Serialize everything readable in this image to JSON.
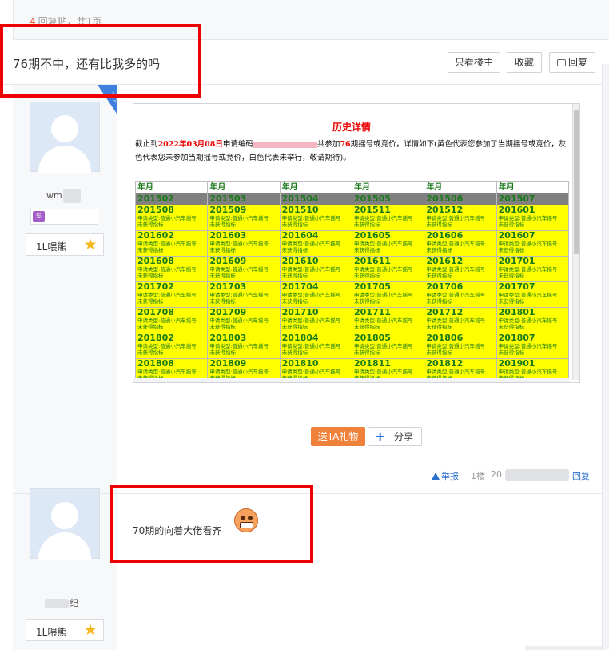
{
  "topbar": {
    "reply_num": "4",
    "reply_text": "回复贴，共1页"
  },
  "thread": {
    "title": "76期不中，还有比我多的吗",
    "buttons": {
      "only_op": "只看楼主",
      "favorite": "收藏",
      "reply": "回复"
    }
  },
  "post1": {
    "user": {
      "name": "wm",
      "level_name": "1L喂熊"
    },
    "corner_badge": "楼主",
    "screenshot": {
      "title": "历史详情",
      "desc_prefix": "截止到",
      "desc_date": "2022年03月08日",
      "desc_mid": "申请编码",
      "desc_mid2": "共参加",
      "desc_count": "76",
      "desc_suffix": "期摇号或竞价，详情如下(黄色代表您参加了当期摇号或竞价，灰色代表您未参加当期摇号或竞价，白色代表未举行，敬请期待)。",
      "header_label": "年月",
      "gray_row": [
        "201502",
        "201503",
        "201504",
        "201505",
        "201506",
        "201507"
      ],
      "yellow_rows": [
        [
          "201508",
          "201509",
          "201510",
          "201511",
          "201512",
          "201601"
        ],
        [
          "201602",
          "201603",
          "201604",
          "201605",
          "201606",
          "201607"
        ],
        [
          "201608",
          "201609",
          "201610",
          "201611",
          "201612",
          "201701"
        ],
        [
          "201702",
          "201703",
          "201704",
          "201705",
          "201706",
          "201707"
        ],
        [
          "201708",
          "201709",
          "201710",
          "201711",
          "201712",
          "201801"
        ],
        [
          "201802",
          "201803",
          "201804",
          "201805",
          "201806",
          "201807"
        ],
        [
          "201808",
          "201809",
          "201810",
          "201811",
          "201812",
          "201901"
        ]
      ],
      "cell_line1": "申请类型:普通小汽车摇号",
      "cell_line2": "未获得指标"
    },
    "gift_label": "送TA礼物",
    "share_label": "分享",
    "report_label": "举报",
    "floor_label": "1楼",
    "date_prefix": "20",
    "reply_label": "回复"
  },
  "post2": {
    "user": {
      "name": "纪",
      "level_name": "1L喂熊"
    },
    "text": "70期的向着大佬看齐"
  },
  "colors": {
    "highlight_box": "#ee0000",
    "accent_blue": "#2b6fcf",
    "gift_orange": "#f0813a"
  },
  "icons": [
    "reply-icon",
    "star-level-icon",
    "share-plus-icon",
    "report-warning-icon",
    "grimace-emoji-icon"
  ]
}
